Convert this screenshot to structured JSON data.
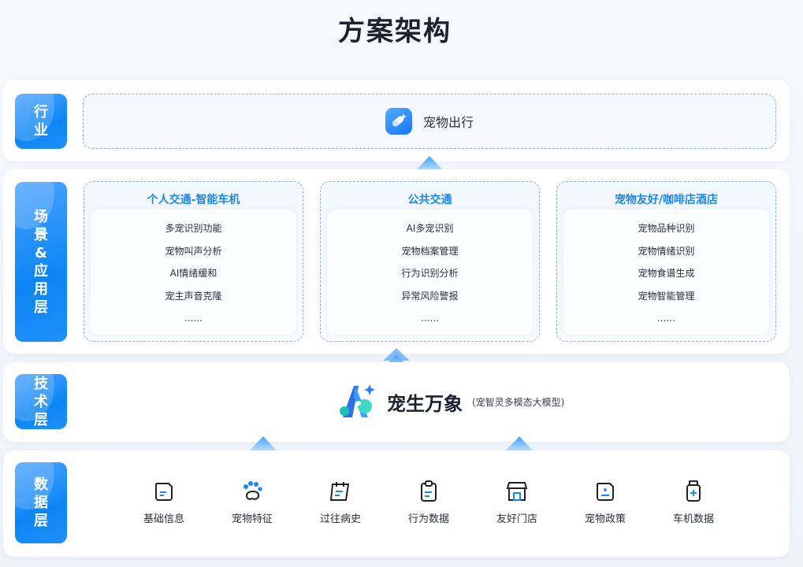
{
  "title": "方案架构",
  "layers": {
    "industry": {
      "tag": [
        "行",
        "业"
      ],
      "item": "宠物出行"
    },
    "scene": {
      "tag": [
        "场",
        "景",
        "&",
        "应",
        "用",
        "层"
      ],
      "columns": [
        {
          "title": "个人交通-智能车机",
          "items": [
            "多宠识别功能",
            "宠物叫声分析",
            "AI情绪缓和",
            "宠主声音克隆",
            "......"
          ]
        },
        {
          "title": "公共交通",
          "items": [
            "AI多宠识别",
            "宠物档案管理",
            "行为识别分析",
            "异常风险警报",
            "......"
          ]
        },
        {
          "title": "宠物友好/咖啡店酒店",
          "items": [
            "宠物品种识别",
            "宠物情绪识别",
            "宠物食谱生成",
            "宠物智能管理",
            "......"
          ]
        }
      ]
    },
    "tech": {
      "tag": [
        "技",
        "术",
        "层"
      ],
      "name": "宠生万象",
      "subtitle": "(宠智灵多模态大模型)"
    },
    "data": {
      "tag": [
        "数",
        "据",
        "层"
      ],
      "items": [
        {
          "label": "基础信息",
          "icon": "note-icon"
        },
        {
          "label": "宠物特征",
          "icon": "paw-icon"
        },
        {
          "label": "过往病史",
          "icon": "calendar-icon"
        },
        {
          "label": "行为数据",
          "icon": "clipboard-icon"
        },
        {
          "label": "友好门店",
          "icon": "store-icon"
        },
        {
          "label": "宠物政策",
          "icon": "policy-icon"
        },
        {
          "label": "车机数据",
          "icon": "bottle-icon"
        }
      ]
    }
  },
  "colors": {
    "accent": "#1b86f5",
    "tag_gradient": [
      "#4aa2ff",
      "#0c86f5"
    ],
    "dash_border": "#8ab3e6"
  }
}
